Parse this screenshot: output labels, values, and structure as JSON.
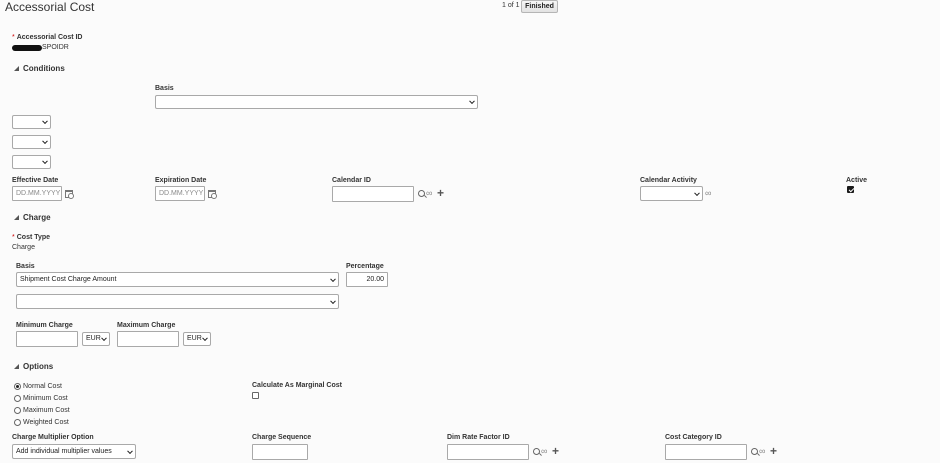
{
  "header": {
    "title": "Accessorial Cost",
    "pager": "1 of 1",
    "finished_label": "Finished"
  },
  "accessorial_cost_id": {
    "required_marker": "*",
    "label": "Accessorial Cost ID",
    "value": "SPOIDR"
  },
  "conditions": {
    "section_label": "Conditions",
    "basis_label": "Basis",
    "basis_value": "",
    "condition_selects": [
      "",
      "",
      ""
    ]
  },
  "dates": {
    "effective_label": "Effective Date",
    "effective_placeholder": "DD.MM.YYYY",
    "expiration_label": "Expiration Date",
    "expiration_placeholder": "DD.MM.YYYY",
    "calendar_id_label": "Calendar ID",
    "calendar_activity_label": "Calendar Activity",
    "active_label": "Active",
    "active_checked": true
  },
  "charge": {
    "section_label": "Charge",
    "cost_type_required_marker": "*",
    "cost_type_label": "Cost Type",
    "cost_type_value": "Charge",
    "basis_label": "Basis",
    "basis_value": "Shipment Cost Charge Amount",
    "percentage_label": "Percentage",
    "percentage_value": "20.00",
    "secondary_basis_value": "",
    "min_charge_label": "Minimum Charge",
    "min_currency": "EUR",
    "max_charge_label": "Maximum Charge",
    "max_currency": "EUR"
  },
  "options": {
    "section_label": "Options",
    "cost_options": [
      {
        "label": "Normal Cost",
        "selected": true
      },
      {
        "label": "Minimum Cost",
        "selected": false
      },
      {
        "label": "Maximum Cost",
        "selected": false
      },
      {
        "label": "Weighted Cost",
        "selected": false
      }
    ],
    "marginal_label": "Calculate As Marginal Cost",
    "marginal_checked": false,
    "multiplier_label": "Charge Multiplier Option",
    "multiplier_value": "Add individual multiplier values",
    "sequence_label": "Charge Sequence",
    "dim_rate_label": "Dim Rate Factor ID",
    "cost_category_label": "Cost Category ID"
  },
  "icons": {
    "calendar": "calendar-icon",
    "search": "search-icon",
    "view": "glasses-icon",
    "add": "plus-icon"
  }
}
